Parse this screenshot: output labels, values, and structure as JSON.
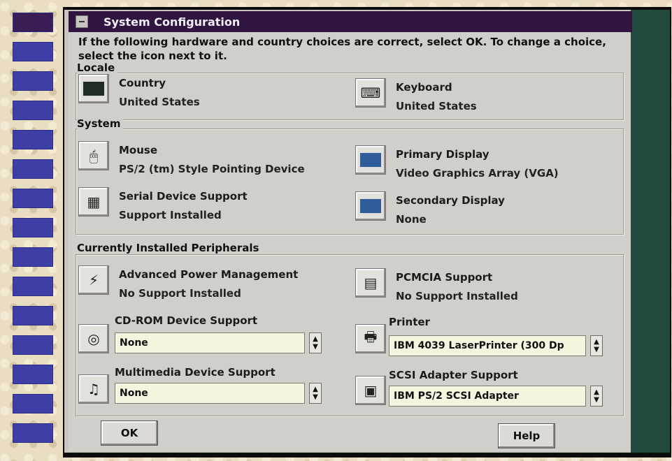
{
  "window": {
    "title": "System Configuration",
    "intro": "If the following hardware and country choices are correct, select OK. To change a choice, select the icon next to it."
  },
  "locale": {
    "label": "Locale",
    "country": {
      "label": "Country",
      "value": "United States",
      "icon": "country-icon"
    },
    "keyboard": {
      "label": "Keyboard",
      "value": "United States",
      "icon": "keyboard-icon"
    }
  },
  "system": {
    "label": "System",
    "mouse": {
      "label": "Mouse",
      "value": "PS/2 (tm) Style Pointing Device",
      "icon": "mouse-icon"
    },
    "primary_display": {
      "label": "Primary Display",
      "value": "Video Graphics Array (VGA)",
      "icon": "monitor-icon"
    },
    "serial": {
      "label": "Serial Device Support",
      "value": "Support Installed",
      "icon": "serial-port-icon"
    },
    "secondary_display": {
      "label": "Secondary Display",
      "value": "None",
      "icon": "monitor-icon"
    }
  },
  "peripherals": {
    "label": "Currently Installed Peripherals",
    "apm": {
      "label": "Advanced Power Management",
      "value": "No Support Installed",
      "icon": "power-management-icon"
    },
    "pcmcia": {
      "label": "PCMCIA Support",
      "value": "No Support Installed",
      "icon": "pcmcia-icon"
    },
    "cdrom": {
      "label": "CD-ROM Device Support",
      "value": "None",
      "icon": "cd-rom-icon"
    },
    "printer": {
      "label": "Printer",
      "value": "IBM 4039 LaserPrinter (300 Dp",
      "icon": "printer-icon"
    },
    "multimedia": {
      "label": "Multimedia Device Support",
      "value": "None",
      "icon": "multimedia-icon"
    },
    "scsi": {
      "label": "SCSI Adapter Support",
      "value": "IBM PS/2 SCSI Adapter",
      "icon": "scsi-adapter-icon"
    }
  },
  "buttons": {
    "ok": "OK",
    "help": "Help"
  },
  "colors": {
    "title_bar": "#2f1540",
    "dialog_bg": "#d1cfc9",
    "field_bg": "#f6f3df",
    "right_panel": "#234a3e",
    "desktop_tiles": "#3d3fa6"
  }
}
